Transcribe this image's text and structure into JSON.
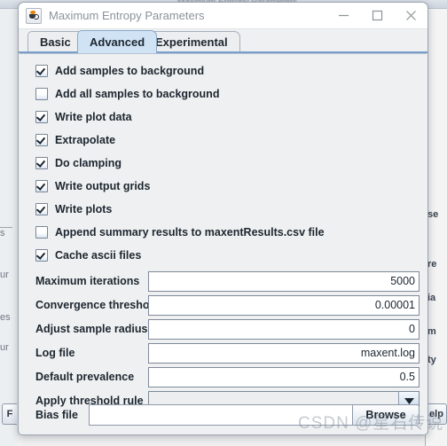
{
  "window": {
    "title": "Maximum Entropy Parameters",
    "icon": "java-coffee-cup-icon",
    "controls": {
      "minimize": "minimize-icon",
      "maximize": "maximize-icon",
      "close": "close-icon"
    }
  },
  "tabs": [
    {
      "label": "Basic",
      "selected": false
    },
    {
      "label": "Advanced",
      "selected": true
    },
    {
      "label": "Experimental",
      "selected": false
    }
  ],
  "checkboxes": [
    {
      "label": "Add samples to background",
      "checked": true
    },
    {
      "label": "Add all samples to background",
      "checked": false
    },
    {
      "label": "Write plot data",
      "checked": true
    },
    {
      "label": "Extrapolate",
      "checked": true
    },
    {
      "label": "Do clamping",
      "checked": true
    },
    {
      "label": "Write output grids",
      "checked": true
    },
    {
      "label": "Write plots",
      "checked": true
    },
    {
      "label": "Append summary results to maxentResults.csv file",
      "checked": false
    },
    {
      "label": "Cache ascii files",
      "checked": true
    }
  ],
  "fields": [
    {
      "label": "Maximum iterations",
      "value": "5000",
      "type": "text"
    },
    {
      "label": "Convergence threshold",
      "value": "0.00001",
      "type": "text"
    },
    {
      "label": "Adjust sample radius",
      "value": "0",
      "type": "text"
    },
    {
      "label": "Log file",
      "value": "maxent.log",
      "type": "text"
    },
    {
      "label": "Default prevalence",
      "value": "0.5",
      "type": "text"
    },
    {
      "label": "Apply threshold rule",
      "value": "",
      "type": "combo",
      "arrow_icon": "chevron-down-icon"
    }
  ],
  "bias_file": {
    "label": "Bias file",
    "value": "",
    "browse_label": "Browse"
  },
  "watermark": "CSDN @星石传说",
  "background_window": {
    "titlebar_text": "Maximum Entropy Parameters",
    "left_fragments": [
      "s",
      "ur",
      "es",
      "ur"
    ],
    "right_fragments": [
      "se",
      "re",
      "ia",
      "m",
      "ty"
    ],
    "left_button": "F",
    "right_button": "elp"
  },
  "colors": {
    "accent": "#7a9ec9",
    "selected_tab": "#cfe3f5",
    "panel": "#eff0f1",
    "text": "#1c2630"
  }
}
